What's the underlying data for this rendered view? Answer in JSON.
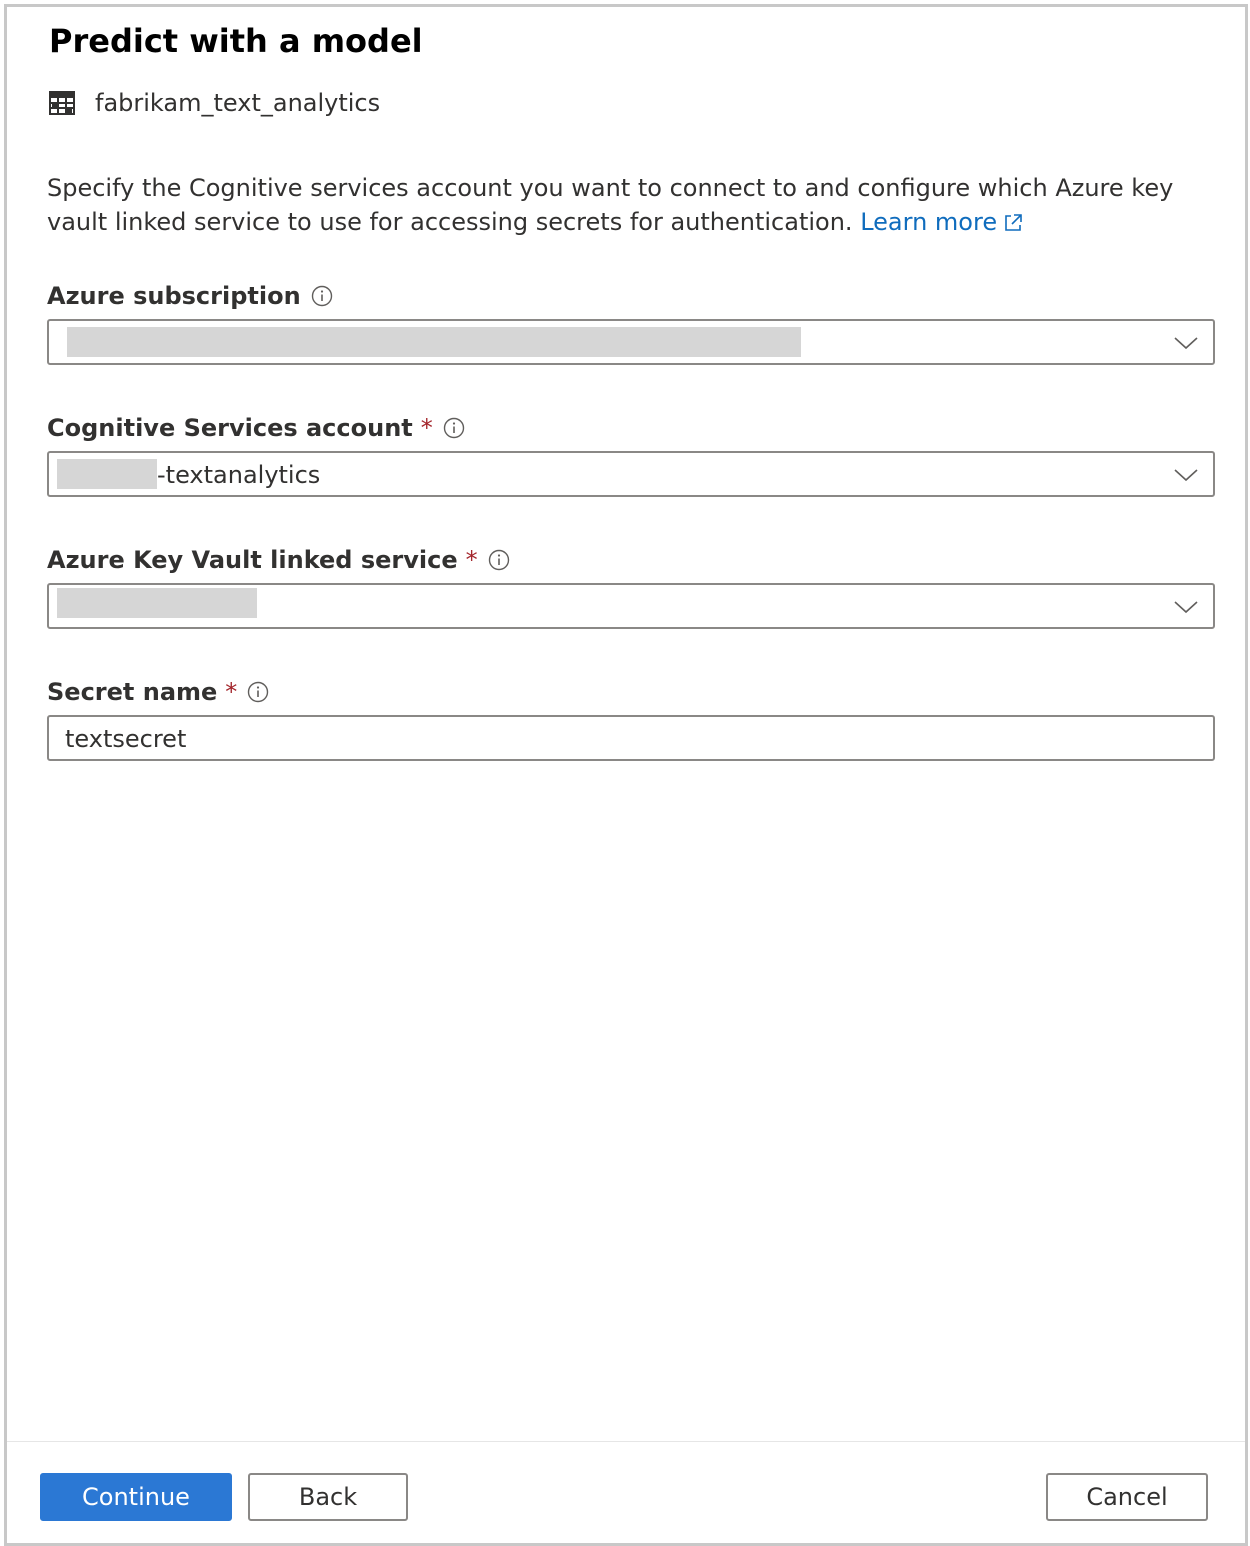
{
  "dialog": {
    "title": "Predict with a model",
    "model_name": "fabrikam_text_analytics",
    "description_text": "Specify the Cognitive services account you want to connect to and configure which Azure key vault linked service to use for accessing secrets for authentication.",
    "learn_more_label": "Learn more"
  },
  "fields": {
    "subscription": {
      "label": "Azure subscription",
      "required": false,
      "value": ""
    },
    "cognitive_account": {
      "label": "Cognitive Services account",
      "required_marker": "*",
      "value_suffix": "-textanalytics"
    },
    "key_vault": {
      "label": "Azure Key Vault linked service",
      "required_marker": "*",
      "value": ""
    },
    "secret_name": {
      "label": "Secret name",
      "required_marker": "*",
      "value": "textsecret"
    }
  },
  "footer": {
    "continue_label": "Continue",
    "back_label": "Back",
    "cancel_label": "Cancel"
  },
  "colors": {
    "primary": "#2b78d4",
    "link": "#0f6cbd",
    "required": "#a4262c",
    "border": "#8a8886",
    "redacted": "#d6d6d6"
  },
  "icons": {
    "model": "table-icon",
    "external_link": "external-link-icon",
    "info": "info-icon",
    "dropdown": "chevron-down-icon"
  }
}
